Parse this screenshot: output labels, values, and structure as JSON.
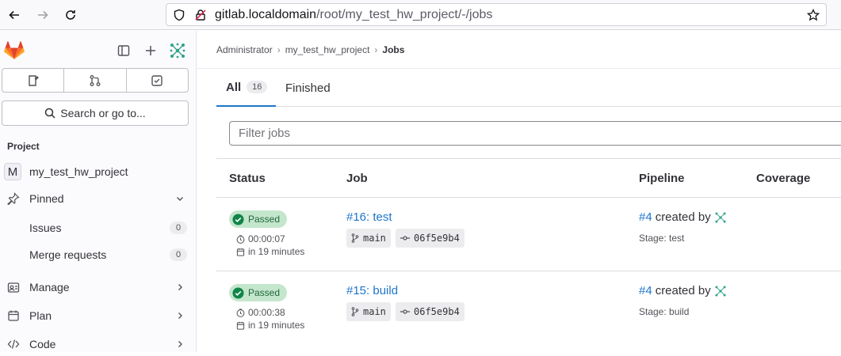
{
  "browser": {
    "url_host": "gitlab.localdomain",
    "url_path": "/root/my_test_hw_project/-/jobs"
  },
  "sidebar": {
    "search_label": "Search or go to...",
    "section_title": "Project",
    "project_avatar": "M",
    "project_name": "my_test_hw_project",
    "pinned_label": "Pinned",
    "issues_label": "Issues",
    "issues_count": "0",
    "mr_label": "Merge requests",
    "mr_count": "0",
    "manage_label": "Manage",
    "plan_label": "Plan",
    "code_label": "Code"
  },
  "breadcrumb": {
    "item1": "Administrator",
    "item2": "my_test_hw_project",
    "current": "Jobs"
  },
  "tabs": {
    "all_label": "All",
    "all_count": "16",
    "finished_label": "Finished"
  },
  "filter": {
    "placeholder": "Filter jobs"
  },
  "table": {
    "headers": {
      "status": "Status",
      "job": "Job",
      "pipeline": "Pipeline",
      "coverage": "Coverage"
    },
    "rows": [
      {
        "status": "Passed",
        "duration": "00:00:07",
        "finished": "in 19 minutes",
        "job": "#16: test",
        "branch": "main",
        "commit": "06f5e9b4",
        "pipeline_id": "#4",
        "created_by": "created by",
        "stage": "Stage: test"
      },
      {
        "status": "Passed",
        "duration": "00:00:38",
        "finished": "in 19 minutes",
        "job": "#15: build",
        "branch": "main",
        "commit": "06f5e9b4",
        "pipeline_id": "#4",
        "created_by": "created by",
        "stage": "Stage: build"
      }
    ]
  },
  "colors": {
    "accent": "#1f75cb",
    "success_bg": "#c3e6cd",
    "success_fg": "#24663b",
    "gitlab_orange": "#e24329"
  }
}
